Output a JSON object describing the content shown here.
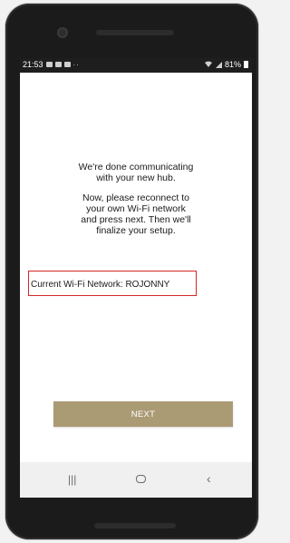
{
  "status_bar": {
    "time": "21:53",
    "extra": "··",
    "battery_text": "81%",
    "icons": [
      "gallery-icon",
      "message-icon",
      "mail-icon",
      "wifi-icon",
      "signal-icon",
      "battery-icon"
    ]
  },
  "content": {
    "message_1": "We're done communicating\nwith your new hub.",
    "message_2": "Now, please reconnect to\nyour own Wi-Fi network\nand press next. Then we'll\nfinalize your setup.",
    "network_label": "Current Wi-Fi Network: ROJONNY"
  },
  "actions": {
    "next_label": "NEXT"
  },
  "nav_bar": {
    "recent_glyph": "|||",
    "back_glyph": "‹"
  },
  "colors": {
    "button": "#ab9b74",
    "highlight_border": "#d42727"
  }
}
